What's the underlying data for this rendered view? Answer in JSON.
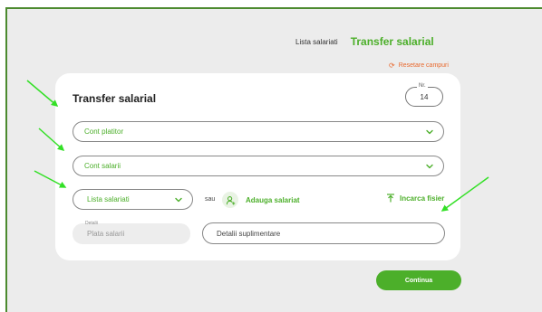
{
  "header": {
    "nav_link": "Lista salariati",
    "nav_active": "Transfer salarial",
    "reset_label": "Resetare campuri"
  },
  "form": {
    "title": "Transfer salarial",
    "nr_label": "Nr.",
    "nr_value": "14",
    "cont_platitor": "Cont platitor",
    "cont_salarii": "Cont salarii",
    "lista_salariati": "Lista salariati",
    "sau": "sau",
    "add_employee": "Adauga salariat",
    "upload_file": "Incarca fisier",
    "detalii_label": "Detalii",
    "detalii_value": "Plata salarii",
    "extra_placeholder": "Detalii suplimentare",
    "continue_label": "Continua"
  },
  "icons": {
    "reset": "refresh-icon",
    "chevron": "chevron-down-icon",
    "add_user": "add-user-icon",
    "upload": "upload-icon"
  },
  "colors": {
    "accent": "#4caf2a",
    "reset": "#e8692e",
    "annotation_arrow": "#33e026",
    "frame_border": "#4c8a2f"
  }
}
